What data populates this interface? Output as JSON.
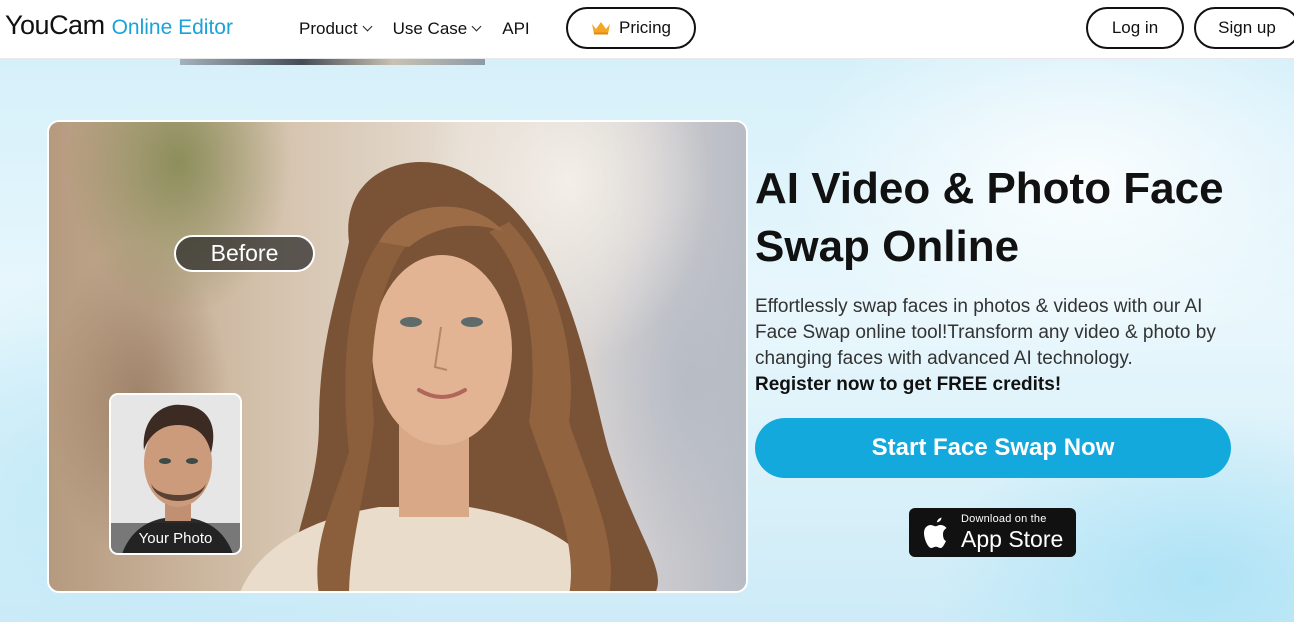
{
  "header": {
    "logo_main": "YouCam",
    "logo_sub": "Online Editor",
    "nav": [
      {
        "label": "Product",
        "has_dropdown": true
      },
      {
        "label": "Use Case",
        "has_dropdown": true
      },
      {
        "label": "API",
        "has_dropdown": false
      }
    ],
    "pricing_label": "Pricing",
    "pricing_icon": "crown-icon",
    "login_label": "Log in",
    "signup_label": "Sign up"
  },
  "hero": {
    "before_label": "Before",
    "your_photo_label": "Your Photo",
    "headline": "AI Video & Photo Face Swap Online",
    "description": "Effortlessly swap faces in photos & videos with our AI Face Swap online tool!Transform any video & photo by changing faces with advanced AI technology.",
    "description_strong": "Register now to get FREE credits!",
    "cta_label": "Start Face Swap Now",
    "appstore_small": "Download on the",
    "appstore_big": "App Store"
  },
  "colors": {
    "accent": "#14a9dd",
    "logo_accent": "#1aa3d9",
    "text": "#111111"
  }
}
